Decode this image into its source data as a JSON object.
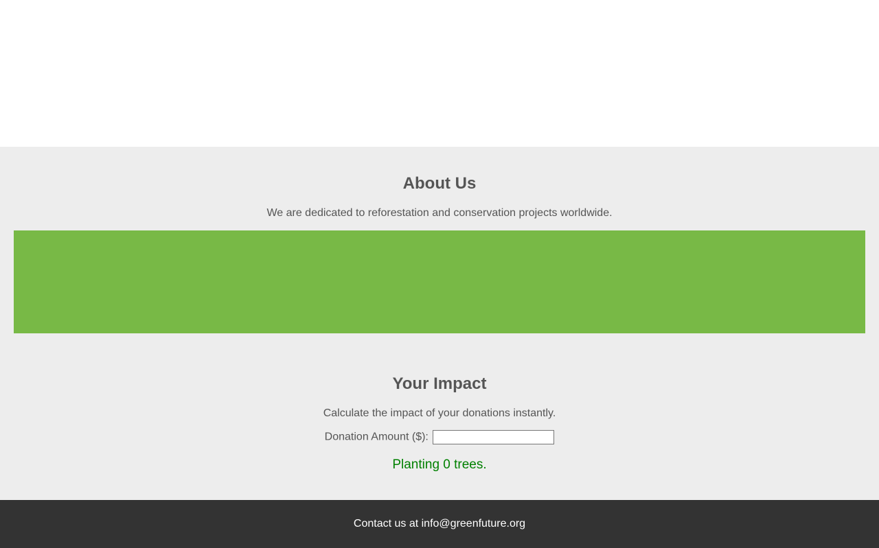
{
  "about": {
    "heading": "About Us",
    "text": "We are dedicated to reforestation and conservation projects worldwide."
  },
  "banner": {
    "color": "#78b946"
  },
  "impact": {
    "heading": "Your Impact",
    "text": "Calculate the impact of your donations instantly.",
    "donation_label": "Donation Amount ($):",
    "donation_value": "",
    "result_text": "Planting 0 trees.",
    "result_color": "#008000"
  },
  "footer": {
    "contact_text": "Contact us at info@greenfuture.org"
  }
}
